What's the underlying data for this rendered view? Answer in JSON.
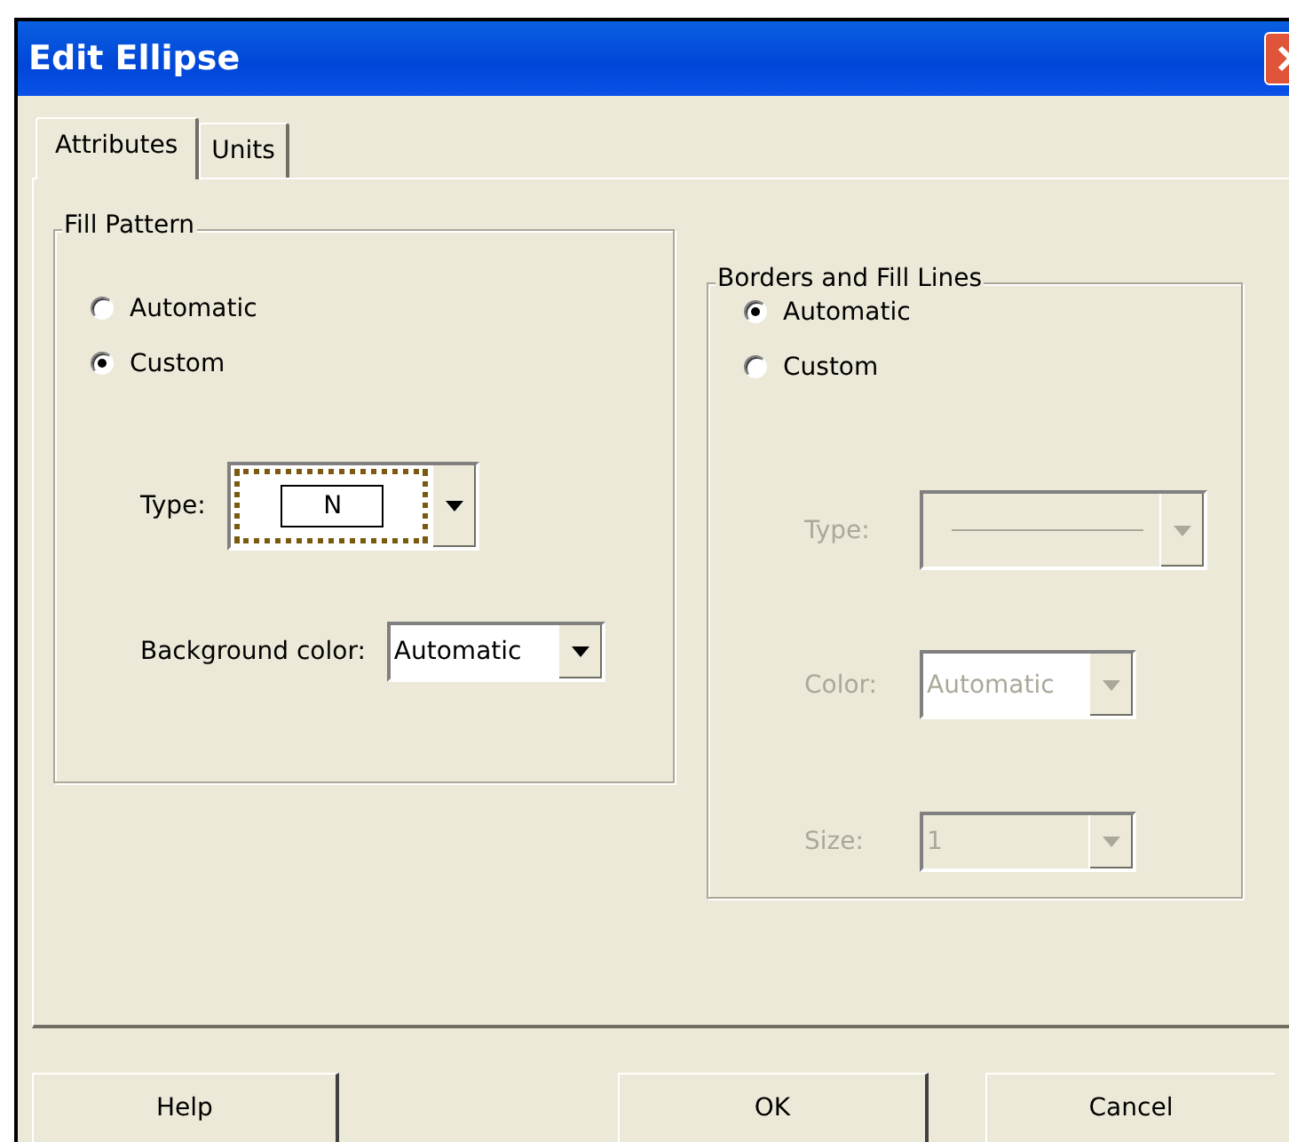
{
  "window": {
    "title": "Edit Ellipse"
  },
  "tabs": [
    {
      "label": "Attributes",
      "selected": true
    },
    {
      "label": "Units",
      "selected": false
    }
  ],
  "groups": [
    {
      "title": "Fill Pattern",
      "disabled": false,
      "options": [
        {
          "label": "Automatic",
          "selected": false
        },
        {
          "label": "Custom",
          "selected": true
        }
      ],
      "fields": [
        {
          "label": "Type:",
          "kind": "pattern",
          "value": "N"
        },
        {
          "label": "Background color:",
          "kind": "list",
          "value": "Automatic"
        }
      ]
    },
    {
      "title": "Borders and Fill Lines",
      "disabled": true,
      "options": [
        {
          "label": "Automatic",
          "selected": true
        },
        {
          "label": "Custom",
          "selected": false
        }
      ],
      "fields": [
        {
          "label": "Type:",
          "kind": "line"
        },
        {
          "label": "Color:",
          "kind": "list",
          "value": "Automatic"
        },
        {
          "label": "Size:",
          "kind": "combo",
          "value": "1"
        }
      ]
    }
  ],
  "buttons": [
    "Help",
    "OK",
    "Cancel"
  ]
}
